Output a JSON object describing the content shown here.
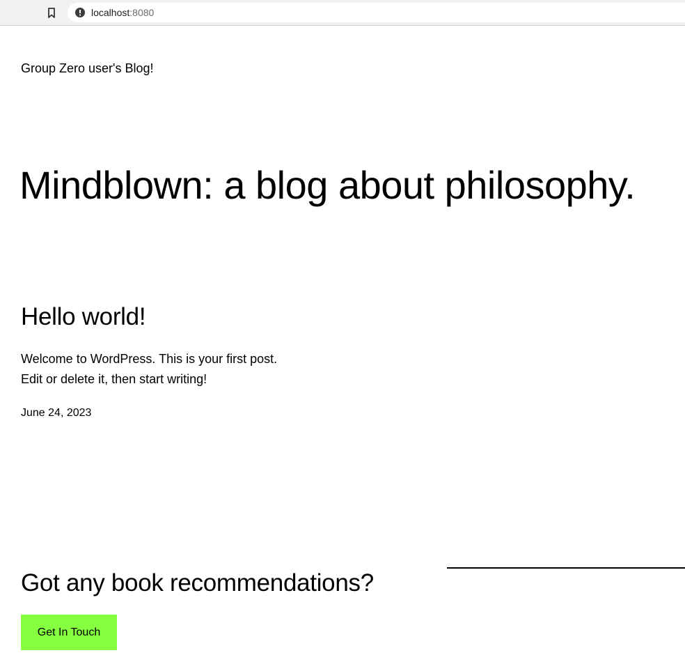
{
  "browser": {
    "url_host": "localhost",
    "url_port": ":8080",
    "icons": [
      "bookmark-icon",
      "info-icon"
    ]
  },
  "site": {
    "title": "Group Zero user's Blog!",
    "tagline": "Mindblown: a blog about philosophy."
  },
  "post": {
    "title": "Hello world!",
    "excerpt": "Welcome to WordPress. This is your first post. Edit or delete it, then start writing!",
    "date": "June 24, 2023"
  },
  "cta": {
    "heading": "Got any book recommendations?",
    "button_label": "Get In Touch",
    "button_color": "#85ff40"
  }
}
